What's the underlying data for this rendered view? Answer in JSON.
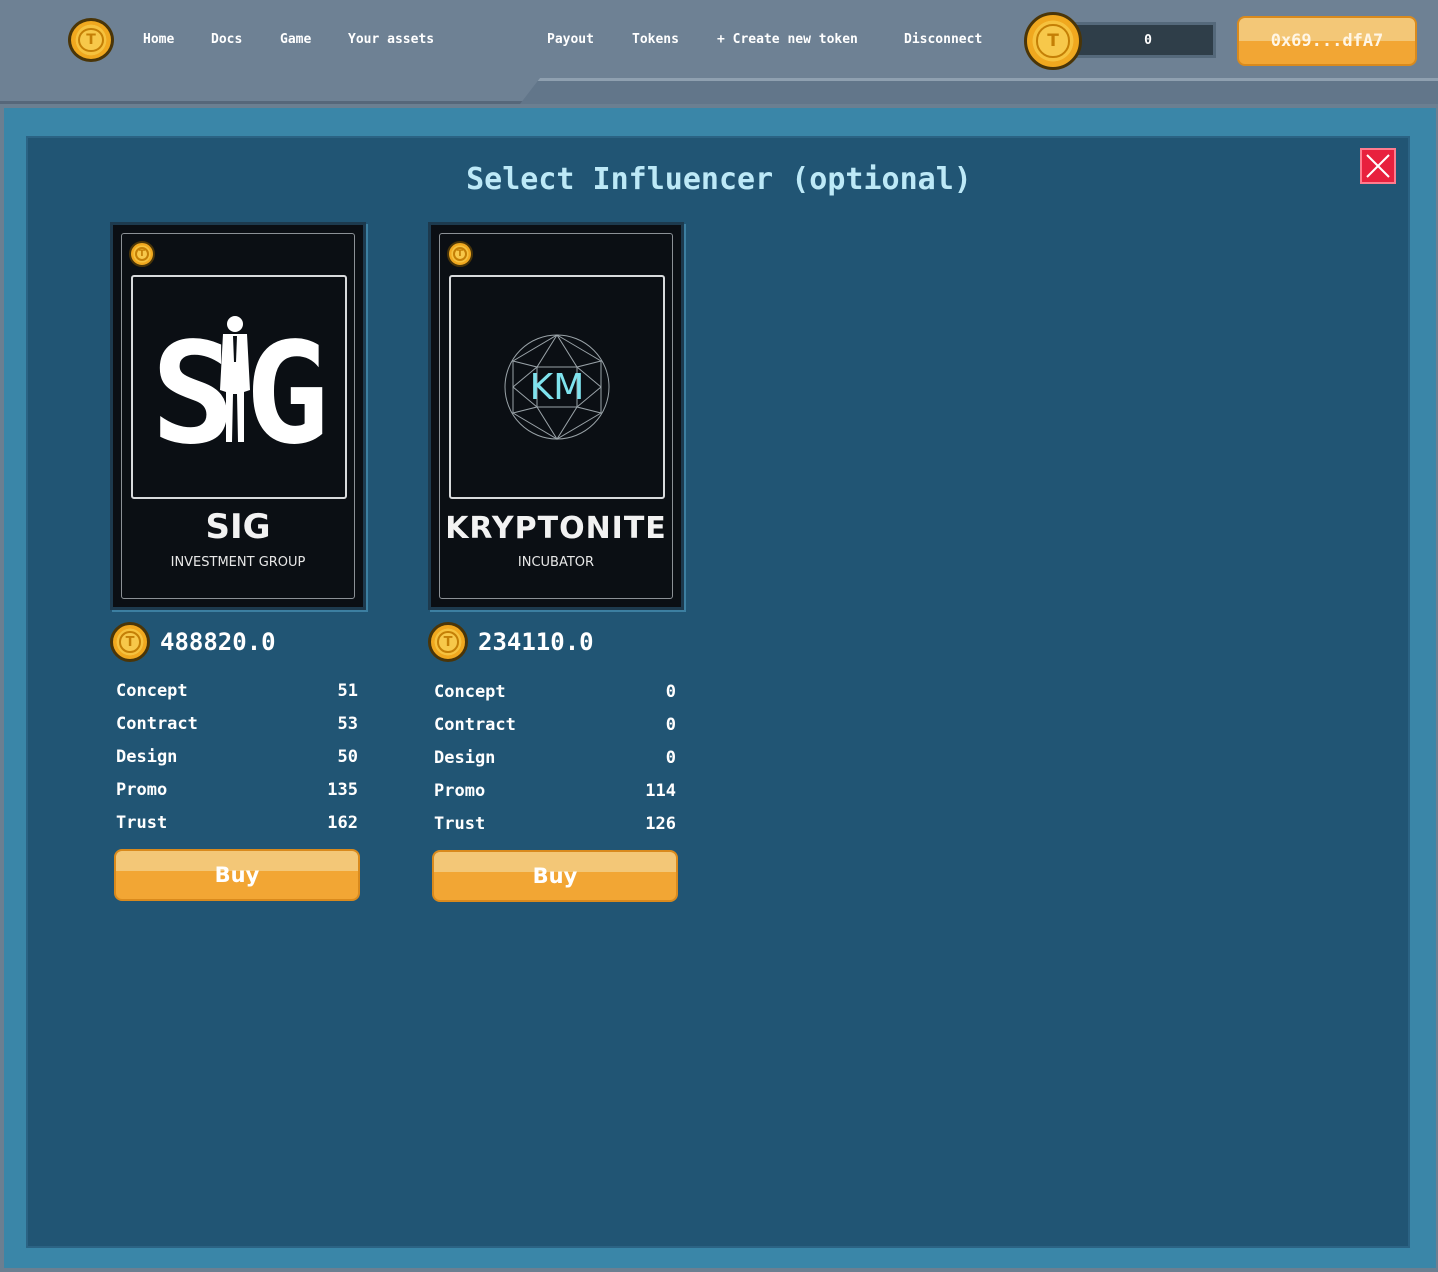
{
  "nav": {
    "home": "Home",
    "docs": "Docs",
    "game": "Game",
    "your_assets": "Your assets",
    "payout": "Payout",
    "tokens": "Tokens",
    "create_token": "+ Create new token",
    "disconnect": "Disconnect",
    "balance": "0",
    "wallet": "0x69...dfA7",
    "logo_icon": "coin-icon",
    "coin_letter": "T"
  },
  "modal": {
    "title": "Select Influencer (optional)",
    "close_icon": "close-icon"
  },
  "influencers": [
    {
      "name": "SIG",
      "subtitle": "INVESTMENT GROUP",
      "logo_text": "S G",
      "price": "488820.0",
      "stats": [
        {
          "label": "Concept",
          "value": "51"
        },
        {
          "label": "Contract",
          "value": "53"
        },
        {
          "label": "Design",
          "value": "50"
        },
        {
          "label": "Promo",
          "value": "135"
        },
        {
          "label": "Trust",
          "value": "162"
        }
      ],
      "buy_label": "Buy"
    },
    {
      "name": "KRYPTONITE",
      "subtitle": "INCUBATOR",
      "logo_text": "KM",
      "price": "234110.0",
      "stats": [
        {
          "label": "Concept",
          "value": "0"
        },
        {
          "label": "Contract",
          "value": "0"
        },
        {
          "label": "Design",
          "value": "0"
        },
        {
          "label": "Promo",
          "value": "114"
        },
        {
          "label": "Trust",
          "value": "126"
        }
      ],
      "buy_label": "Buy"
    }
  ],
  "colors": {
    "accent_orange": "#f2a634",
    "modal_bg": "#215574",
    "title_text": "#bde9f7",
    "close_red": "#e8203e",
    "kryptonite_glow": "#7fe3ee"
  }
}
